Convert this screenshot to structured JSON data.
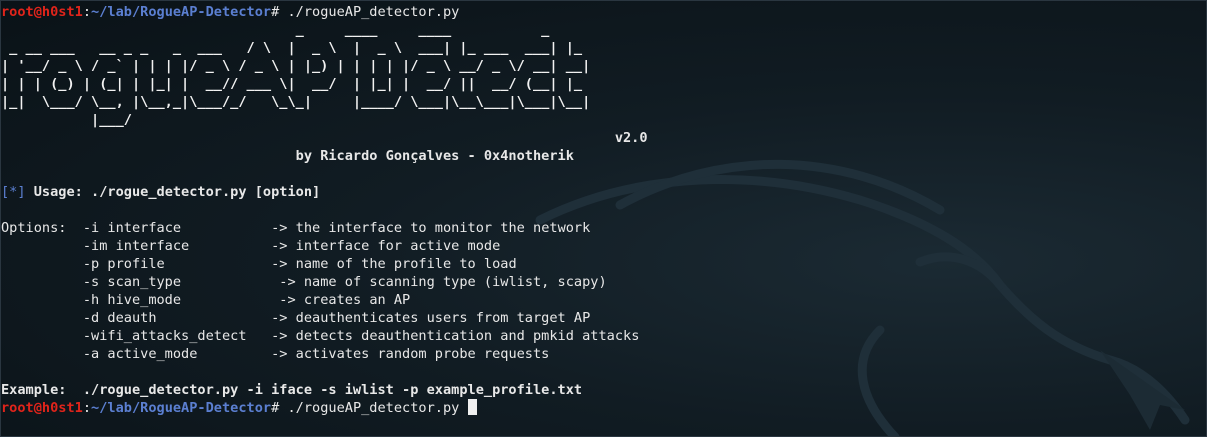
{
  "prompt1": {
    "user": "root@h0st1",
    "sep": ":",
    "path": "~/lab/RogueAP-Detector",
    "symbol": "# ",
    "command": "./rogueAP_detector.py"
  },
  "banner": {
    "ascii": "                                    _     ____     ____           _\n _ __ ___   __ _ _   _  ___   / \\  |  _ \\  |  _ \\  ___| |_ ___  ___| |_\n| '__/ _ \\ / _` | | | |/ _ \\ / _ \\ | |_) | | | | |/ _ \\ __/ _ \\/ __| __|\n| | | (_) | (_| | |_| |  __// ___ \\|  __/  | |_| |  __/ ||  __/ (__| |_\n|_|  \\___/ \\__, |\\__,_|\\___/_/   \\_\\_|     |____/ \\___|\\__\\___|\\___|\\__|\n           |___/",
    "version": "v2.0",
    "author": "by Ricardo Gonçalves - 0x4notherik"
  },
  "usage": {
    "bracket": "[*]",
    "text": " Usage: ./rogue_detector.py [option]"
  },
  "options": {
    "header": "Options:",
    "items": [
      {
        "flag": "-i interface",
        "desc": "the interface to monitor the network"
      },
      {
        "flag": "-im interface",
        "desc": "interface for active mode"
      },
      {
        "flag": "-p profile",
        "desc": "name of the profile to load"
      },
      {
        "flag": "-s scan_type",
        "desc": "name of scanning type (iwlist, scapy)"
      },
      {
        "flag": "-h hive_mode",
        "desc": "creates an AP"
      },
      {
        "flag": "-d deauth",
        "desc": "deauthenticates users from target AP"
      },
      {
        "flag": "-wifi_attacks_detect",
        "desc": "detects deauthentication and pmkid attacks"
      },
      {
        "flag": "-a active_mode",
        "desc": "activates random probe requests"
      }
    ],
    "arrow": "-> "
  },
  "example": {
    "label": "Example:",
    "command": "./rogue_detector.py -i iface -s iwlist -p example_profile.txt"
  },
  "prompt2": {
    "user": "root@h0st1",
    "sep": ":",
    "path": "~/lab/RogueAP-Detector",
    "symbol": "# ",
    "command": "./rogueAP_detector.py"
  },
  "colors": {
    "background": "#0e171e",
    "prompt_user": "#e0241b",
    "prompt_path": "#5b7fd1",
    "text": "#e8e8e8"
  }
}
